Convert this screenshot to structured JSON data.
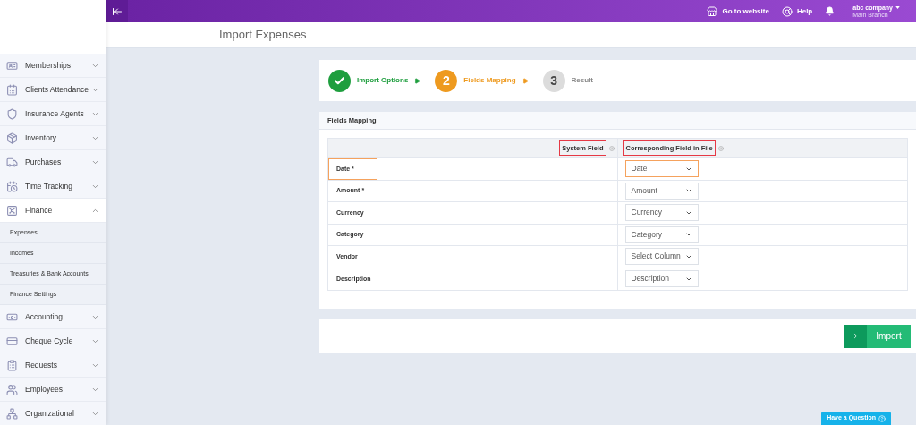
{
  "topbar": {
    "links": [
      {
        "kind": "website",
        "label": "Go to website"
      },
      {
        "kind": "help",
        "label": "Help"
      }
    ],
    "account": {
      "company": "abc company",
      "branch": "Main Branch"
    }
  },
  "page_title": "Import Expenses",
  "sidebar": {
    "items": [
      {
        "label": "Memberships",
        "expanded": false
      },
      {
        "label": "Clients Attendance",
        "expanded": false
      },
      {
        "label": "Insurance Agents",
        "expanded": false
      },
      {
        "label": "Inventory",
        "expanded": false
      },
      {
        "label": "Purchases",
        "expanded": false
      },
      {
        "label": "Time Tracking",
        "expanded": false
      },
      {
        "label": "Finance",
        "expanded": true,
        "children": [
          {
            "label": "Expenses"
          },
          {
            "label": "Incomes"
          },
          {
            "label": "Treasuries & Bank Accounts"
          },
          {
            "label": "Finance Settings"
          }
        ]
      },
      {
        "label": "Accounting",
        "expanded": false
      },
      {
        "label": "Cheque Cycle",
        "expanded": false
      },
      {
        "label": "Requests",
        "expanded": false
      },
      {
        "label": "Employees",
        "expanded": false
      },
      {
        "label": "Organizational",
        "expanded": false
      }
    ]
  },
  "steps": [
    {
      "label": "Import Options",
      "completed": true,
      "selected": false
    },
    {
      "marker": "2",
      "label": "Fields Mapping",
      "completed": false,
      "selected": true
    },
    {
      "marker": "3",
      "label": "Result",
      "completed": false,
      "selected": false
    }
  ],
  "mapping": {
    "title": "Fields Mapping",
    "columns": [
      {
        "label": "System Field",
        "highlighted": true
      },
      {
        "label": "Corresponding Field in File",
        "highlighted": true
      }
    ],
    "rows": [
      {
        "label": "Date *",
        "value": "Date",
        "highlighted": true
      },
      {
        "label": "Amount *",
        "value": "Amount",
        "highlighted": false
      },
      {
        "label": "Currency",
        "value": "Currency",
        "highlighted": false
      },
      {
        "label": "Category",
        "value": "Category",
        "highlighted": false
      },
      {
        "label": "Vendor",
        "value": "Select Column",
        "highlighted": false
      },
      {
        "label": "Description",
        "value": "Description",
        "highlighted": false
      }
    ]
  },
  "import_button": {
    "label": "Import"
  },
  "help_button": {
    "label": "Have a Question"
  }
}
